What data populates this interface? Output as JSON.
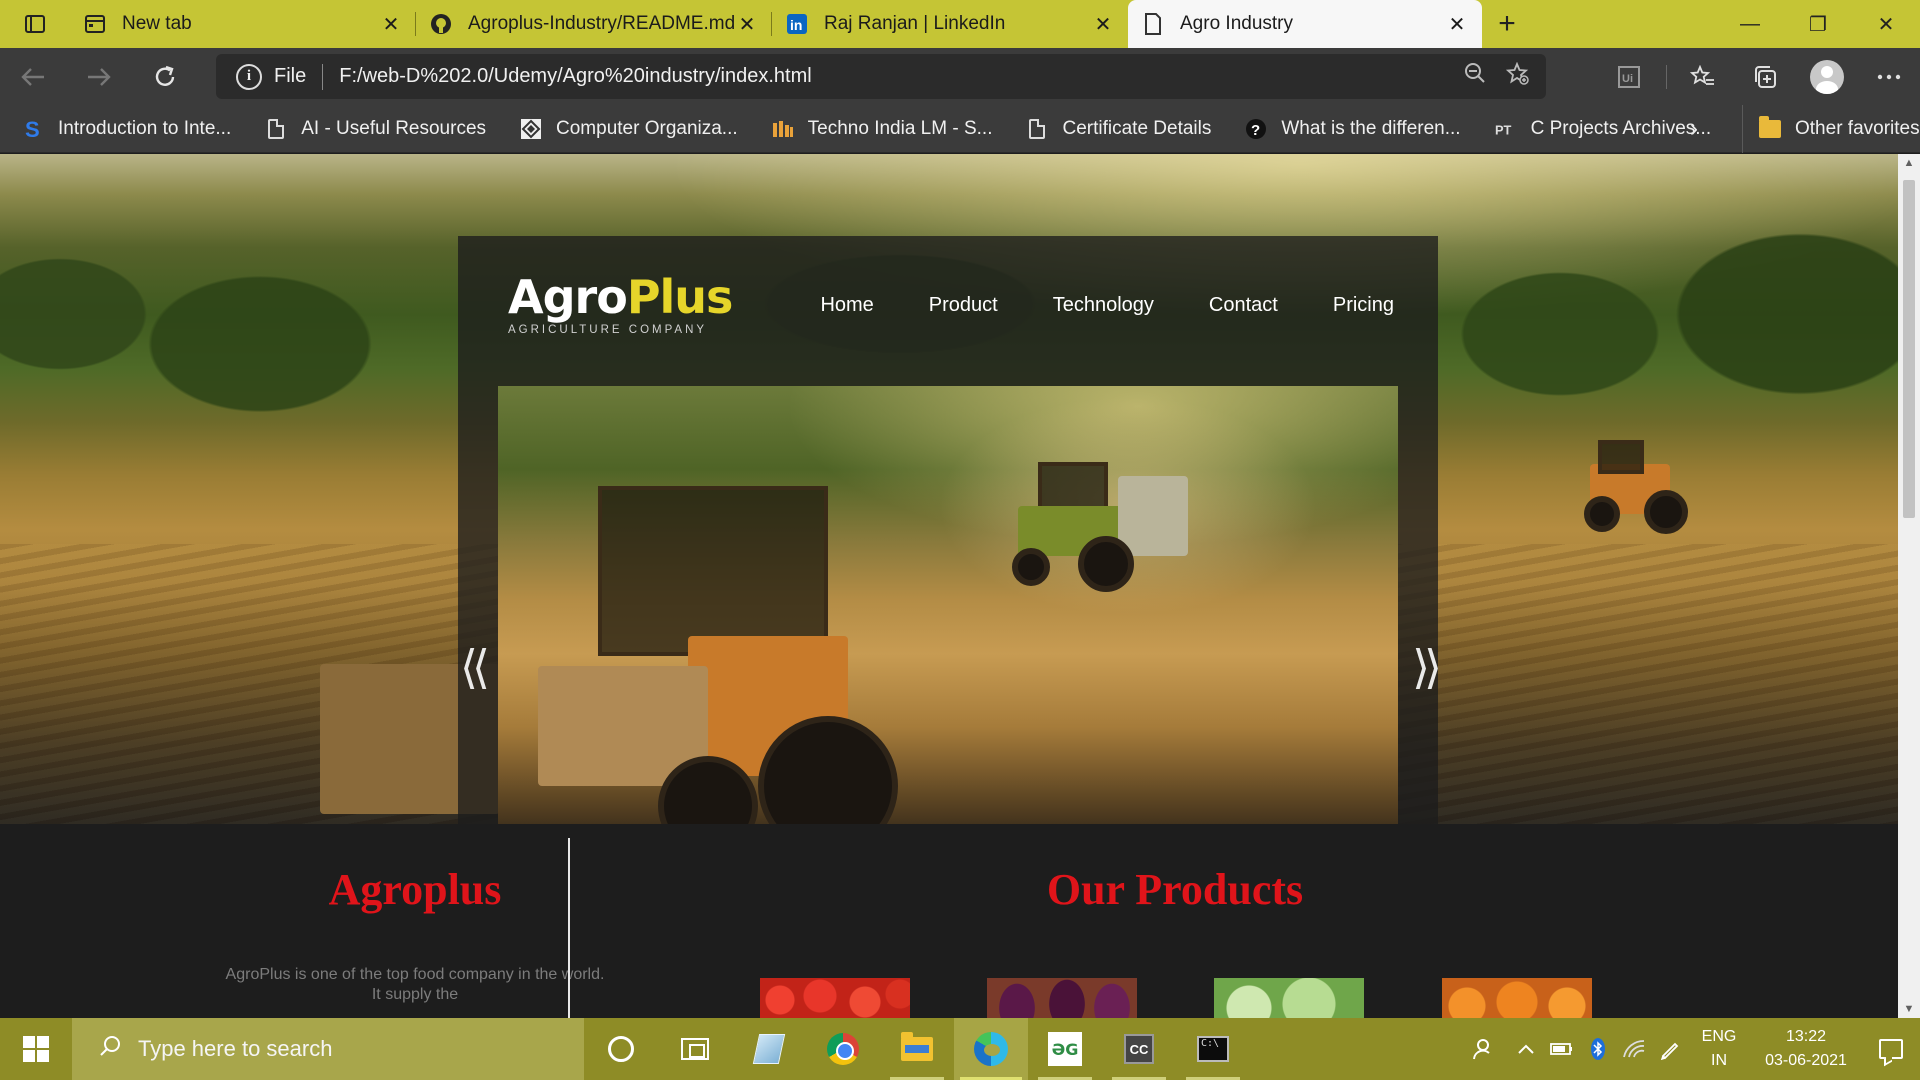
{
  "browser": {
    "tabs": [
      {
        "title": "New tab",
        "icon": "newtab-icon",
        "active": false
      },
      {
        "title": "Agroplus-Industry/README.md at",
        "icon": "github-icon",
        "active": false
      },
      {
        "title": "Raj Ranjan | LinkedIn",
        "icon": "linkedin-icon",
        "active": false
      },
      {
        "title": "Agro Industry",
        "icon": "page-icon",
        "active": true
      }
    ],
    "close_glyph": "✕",
    "new_tab_glyph": "+",
    "window_controls": {
      "minimize": "—",
      "restore": "❐",
      "close": "✕"
    },
    "address": {
      "scheme_label": "File",
      "url": "F:/web-D%202.0/Udemy/Agro%20industry/index.html"
    },
    "favorites": [
      {
        "label": "Introduction to Inte...",
        "icon": "s-logo-icon"
      },
      {
        "label": "AI - Useful Resources",
        "icon": "page-icon"
      },
      {
        "label": "Computer Organiza...",
        "icon": "diamond-icon"
      },
      {
        "label": "Techno India LM - S...",
        "icon": "techno-india-icon"
      },
      {
        "label": "Certificate Details",
        "icon": "page-icon"
      },
      {
        "label": "What is the differen...",
        "icon": "question-icon"
      },
      {
        "label": "C Projects Archives...",
        "icon": "pt-icon"
      }
    ],
    "other_favorites": "Other favorites",
    "chevron": "›"
  },
  "site": {
    "logo": {
      "part1": "Agro",
      "part2": "Plus",
      "tagline": "AGRICULTURE COMPANY"
    },
    "menu": [
      "Home",
      "Product",
      "Technology",
      "Contact",
      "Pricing"
    ],
    "slider_prev": "⟨⟨",
    "slider_next": "⟩⟩",
    "about": {
      "title": "Agroplus",
      "text": "AgroPlus is one of the top food company in the world. It supply the"
    },
    "products_title": "Our Products",
    "products": [
      "tomatoes",
      "eggplants",
      "cabbages",
      "oranges"
    ],
    "colors": {
      "accent_red": "#e0141a",
      "logo_yellow": "#e6d52a",
      "tabstrip": "#c5c535"
    }
  },
  "taskbar": {
    "search_placeholder": "Type here to search",
    "apps": [
      "cortana",
      "task-view",
      "notebook",
      "chrome",
      "file-explorer",
      "edge",
      "geeksforgeeks",
      "codeblocks",
      "terminal"
    ],
    "language": {
      "line1": "ENG",
      "line2": "IN"
    },
    "time": "13:22",
    "date": "03-06-2021"
  }
}
